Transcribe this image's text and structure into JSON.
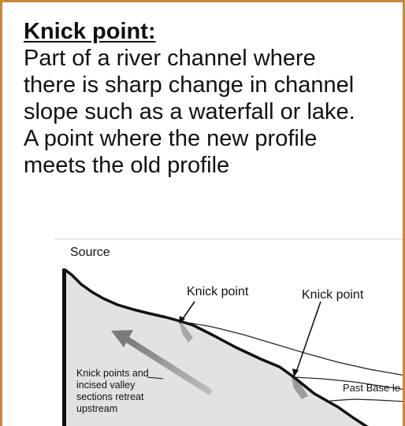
{
  "definition": {
    "heading": "Knick point:",
    "lines": [
      "Part of a river channel where",
      "there is sharp change in channel",
      "slope such as a waterfall or lake.",
      "A point where the new profile",
      "meets the old profile"
    ]
  },
  "diagram": {
    "source_label": "Source",
    "knick_label_1": "Knick point",
    "knick_label_2": "Knick point",
    "past_base_label": "Past Base le",
    "note_lines": [
      "Knick points and",
      "incised valley",
      "sections retreat",
      "upstream"
    ]
  }
}
